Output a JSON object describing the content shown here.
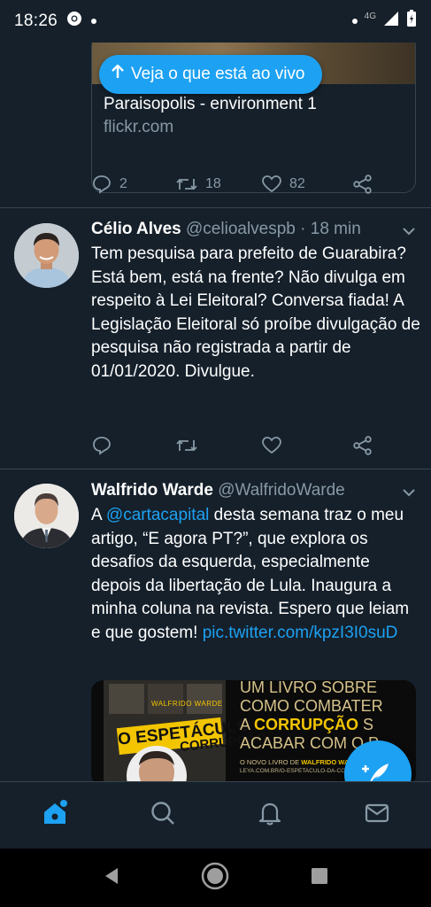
{
  "status_bar": {
    "time": "18:26",
    "network": "4G"
  },
  "tweet1": {
    "live_button": "Veja o que está ao vivo",
    "card_title": "Paraisopolis - environment 1",
    "card_domain": "flickr.com",
    "replies": "2",
    "retweets": "18",
    "likes": "82"
  },
  "tweet2": {
    "name": "Célio Alves",
    "handle": "@celioalvespb",
    "time": "· 18 min",
    "text": "Tem pesquisa para prefeito de Guarabira? Está bem, está na frente? Não divulga em respeito à Lei Eleitoral? Conversa fiada! A Legislação Eleitoral só proíbe divulgação de pesquisa não registrada a partir de 01/01/2020. Divulgue."
  },
  "tweet3": {
    "name": "Walfrido Warde",
    "handle": "@WalfridoWarde",
    "text_pre": "A ",
    "mention": "@cartacapital",
    "text_mid": " desta semana traz o meu artigo, “E agora PT?”, que explora os desafios da esquerda, especialmente depois da libertação de Lula. Inaugura a minha coluna na revista. Espero que leiam e que gostem! ",
    "pic_link": "pic.twitter.com/kpzI3I0suD",
    "card": {
      "line1": "UM LIVRO SOBRE",
      "line2": "COMO COMBATER",
      "line3a": "A ",
      "line3b": "CORRUPÇÃO",
      "line3c": " S",
      "line4": "ACABAR COM O P",
      "small1a": "O NOVO LIVRO DE ",
      "small1b": "WALFRIDO WARDE",
      "small2": "LEYA.COM.BR/O-ESPETACULO-DA-CORRUPCAO",
      "book_author": "WALFRIDO WARDE",
      "book_title1": "O ESPETÁCULO",
      "book_title2": "CORRUPÇÃO"
    }
  },
  "colors": {
    "background": "#15202b",
    "accent": "#1da1f2",
    "muted": "#8899a6",
    "divider": "#38444d"
  },
  "icons": [
    "reply-icon",
    "retweet-icon",
    "like-icon",
    "share-icon",
    "chevron-down-icon",
    "home-icon",
    "search-icon",
    "bell-icon",
    "mail-icon",
    "compose-icon"
  ]
}
